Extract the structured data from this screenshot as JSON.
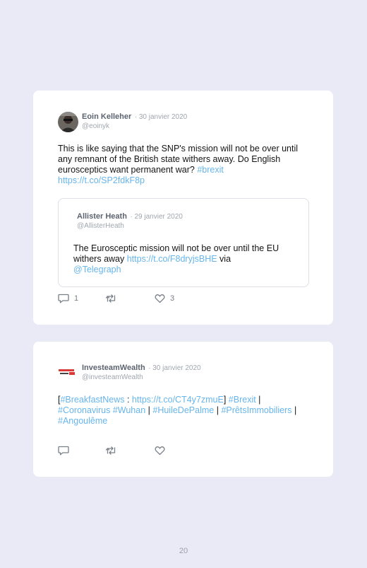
{
  "tweets": [
    {
      "author": "Eoin Kelleher",
      "date": "· 30 janvier 2020",
      "handle": "@eoinyk",
      "text_plain": "This is like saying that the SNP's mission will not be over until any remnant of the British state withers away. Do English eurosceptics want permanent war? ",
      "hashtag": "#brexit",
      "link": "https://t.co/SP2fdkF8p",
      "quoted": {
        "author": "Allister Heath",
        "date": "· 29 janvier 2020",
        "handle": "@AllisterHeath",
        "text_plain": "The Eurosceptic mission will not be over until the EU withers away ",
        "link": "https://t.co/F8dryjsBHE",
        "via": " via ",
        "mention": "@Telegraph"
      },
      "reply_count": "1",
      "retweet_count": "",
      "like_count": "3"
    },
    {
      "author": "InvesteamWealth",
      "date": "· 30 janvier 2020",
      "handle": "@investeamWealth",
      "t0": "[",
      "t1": "#BreakfastNews",
      "t2": " : ",
      "t3": "https://t.co/CT4y7zmuE",
      "t4": "] ",
      "t5": "#Brexit",
      "t6": " | ",
      "t7": "#Coronavirus",
      "t8": " ",
      "t9": "#Wuhan",
      "t10": " | ",
      "t11": "#HuileDePalme",
      "t12": " | ",
      "t13": "#PrêtsImmobiliers",
      "t14": " | ",
      "t15": "#Angoulême"
    }
  ],
  "icons": {
    "reply": "reply-icon",
    "retweet": "retweet-icon",
    "like": "heart-icon"
  },
  "colors": {
    "background": "#e9eaf5",
    "card": "#ffffff",
    "link": "#66b5ec",
    "text": "#141414",
    "muted": "#a0a6ae"
  },
  "page_number": "20"
}
